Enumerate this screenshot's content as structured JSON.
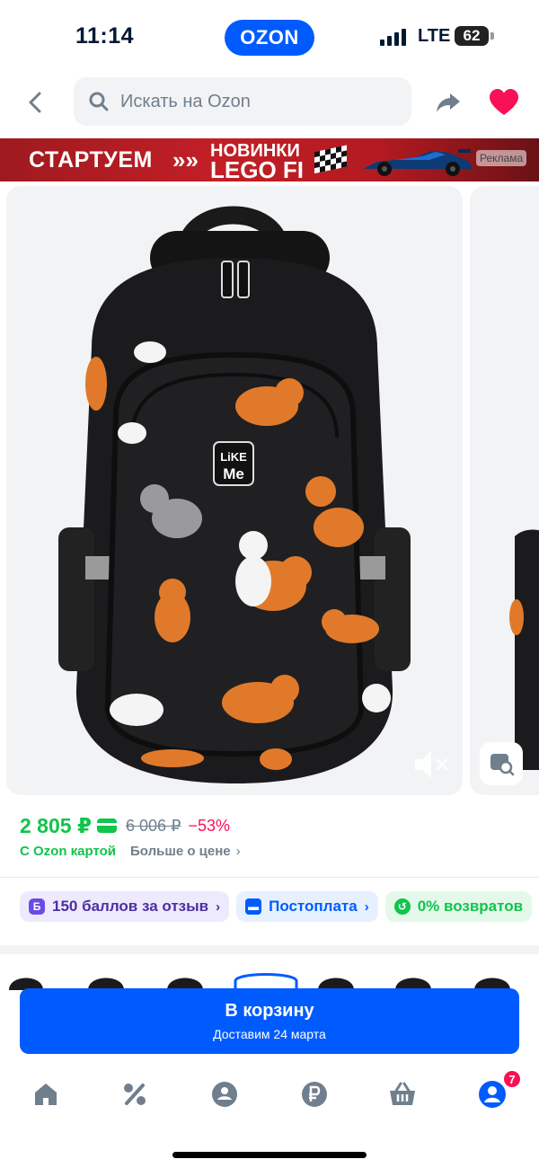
{
  "status_bar": {
    "time": "11:14",
    "brand": "OZON",
    "network": "LTE",
    "battery": "62"
  },
  "search": {
    "placeholder": "Искать на Ozon"
  },
  "banner": {
    "left_text": "СТАРТУЕМ",
    "arrows": "»»",
    "line1": "НОВИНКИ",
    "line2": "LEGO FI",
    "ad_label": "Реклама"
  },
  "product": {
    "price": "2 805 ₽",
    "old_price": "6 006 ₽",
    "discount": "−53%",
    "card_note": "С Ozon картой",
    "more_price": "Больше о цене",
    "logo_line1": "LiKE",
    "logo_line2": "Me"
  },
  "chips": [
    {
      "icon": "Б",
      "label": "150 баллов за отзыв"
    },
    {
      "icon": "",
      "label": "Постоплата"
    },
    {
      "icon": "",
      "label": "0% возвратов"
    }
  ],
  "cart_button": {
    "title": "В корзину",
    "subtitle": "Доставим 24 марта"
  },
  "tabbar": {
    "cart_badge": "7",
    "icons": [
      "home-icon",
      "percent-icon",
      "catalog-icon",
      "ruble-icon",
      "basket-icon",
      "profile-icon"
    ]
  },
  "colors": {
    "brand_blue": "#005bff",
    "price_green": "#10c44c",
    "discount_pink": "#f91155"
  }
}
